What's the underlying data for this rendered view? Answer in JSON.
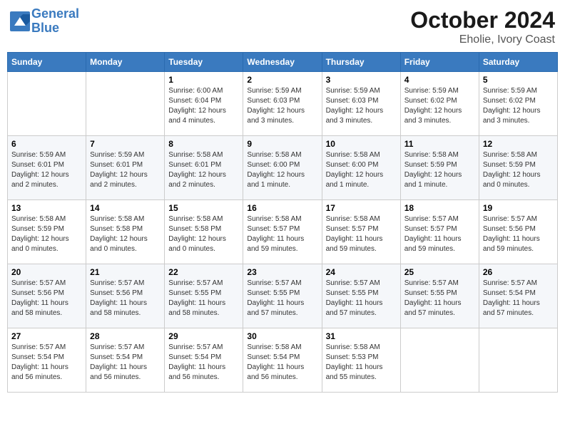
{
  "header": {
    "logo_line1": "General",
    "logo_line2": "Blue",
    "month_title": "October 2024",
    "location": "Eholie, Ivory Coast"
  },
  "weekdays": [
    "Sunday",
    "Monday",
    "Tuesday",
    "Wednesday",
    "Thursday",
    "Friday",
    "Saturday"
  ],
  "weeks": [
    [
      {
        "day": "",
        "info": ""
      },
      {
        "day": "",
        "info": ""
      },
      {
        "day": "1",
        "info": "Sunrise: 6:00 AM\nSunset: 6:04 PM\nDaylight: 12 hours\nand 4 minutes."
      },
      {
        "day": "2",
        "info": "Sunrise: 5:59 AM\nSunset: 6:03 PM\nDaylight: 12 hours\nand 3 minutes."
      },
      {
        "day": "3",
        "info": "Sunrise: 5:59 AM\nSunset: 6:03 PM\nDaylight: 12 hours\nand 3 minutes."
      },
      {
        "day": "4",
        "info": "Sunrise: 5:59 AM\nSunset: 6:02 PM\nDaylight: 12 hours\nand 3 minutes."
      },
      {
        "day": "5",
        "info": "Sunrise: 5:59 AM\nSunset: 6:02 PM\nDaylight: 12 hours\nand 3 minutes."
      }
    ],
    [
      {
        "day": "6",
        "info": "Sunrise: 5:59 AM\nSunset: 6:01 PM\nDaylight: 12 hours\nand 2 minutes."
      },
      {
        "day": "7",
        "info": "Sunrise: 5:59 AM\nSunset: 6:01 PM\nDaylight: 12 hours\nand 2 minutes."
      },
      {
        "day": "8",
        "info": "Sunrise: 5:58 AM\nSunset: 6:01 PM\nDaylight: 12 hours\nand 2 minutes."
      },
      {
        "day": "9",
        "info": "Sunrise: 5:58 AM\nSunset: 6:00 PM\nDaylight: 12 hours\nand 1 minute."
      },
      {
        "day": "10",
        "info": "Sunrise: 5:58 AM\nSunset: 6:00 PM\nDaylight: 12 hours\nand 1 minute."
      },
      {
        "day": "11",
        "info": "Sunrise: 5:58 AM\nSunset: 5:59 PM\nDaylight: 12 hours\nand 1 minute."
      },
      {
        "day": "12",
        "info": "Sunrise: 5:58 AM\nSunset: 5:59 PM\nDaylight: 12 hours\nand 0 minutes."
      }
    ],
    [
      {
        "day": "13",
        "info": "Sunrise: 5:58 AM\nSunset: 5:59 PM\nDaylight: 12 hours\nand 0 minutes."
      },
      {
        "day": "14",
        "info": "Sunrise: 5:58 AM\nSunset: 5:58 PM\nDaylight: 12 hours\nand 0 minutes."
      },
      {
        "day": "15",
        "info": "Sunrise: 5:58 AM\nSunset: 5:58 PM\nDaylight: 12 hours\nand 0 minutes."
      },
      {
        "day": "16",
        "info": "Sunrise: 5:58 AM\nSunset: 5:57 PM\nDaylight: 11 hours\nand 59 minutes."
      },
      {
        "day": "17",
        "info": "Sunrise: 5:58 AM\nSunset: 5:57 PM\nDaylight: 11 hours\nand 59 minutes."
      },
      {
        "day": "18",
        "info": "Sunrise: 5:57 AM\nSunset: 5:57 PM\nDaylight: 11 hours\nand 59 minutes."
      },
      {
        "day": "19",
        "info": "Sunrise: 5:57 AM\nSunset: 5:56 PM\nDaylight: 11 hours\nand 59 minutes."
      }
    ],
    [
      {
        "day": "20",
        "info": "Sunrise: 5:57 AM\nSunset: 5:56 PM\nDaylight: 11 hours\nand 58 minutes."
      },
      {
        "day": "21",
        "info": "Sunrise: 5:57 AM\nSunset: 5:56 PM\nDaylight: 11 hours\nand 58 minutes."
      },
      {
        "day": "22",
        "info": "Sunrise: 5:57 AM\nSunset: 5:55 PM\nDaylight: 11 hours\nand 58 minutes."
      },
      {
        "day": "23",
        "info": "Sunrise: 5:57 AM\nSunset: 5:55 PM\nDaylight: 11 hours\nand 57 minutes."
      },
      {
        "day": "24",
        "info": "Sunrise: 5:57 AM\nSunset: 5:55 PM\nDaylight: 11 hours\nand 57 minutes."
      },
      {
        "day": "25",
        "info": "Sunrise: 5:57 AM\nSunset: 5:55 PM\nDaylight: 11 hours\nand 57 minutes."
      },
      {
        "day": "26",
        "info": "Sunrise: 5:57 AM\nSunset: 5:54 PM\nDaylight: 11 hours\nand 57 minutes."
      }
    ],
    [
      {
        "day": "27",
        "info": "Sunrise: 5:57 AM\nSunset: 5:54 PM\nDaylight: 11 hours\nand 56 minutes."
      },
      {
        "day": "28",
        "info": "Sunrise: 5:57 AM\nSunset: 5:54 PM\nDaylight: 11 hours\nand 56 minutes."
      },
      {
        "day": "29",
        "info": "Sunrise: 5:57 AM\nSunset: 5:54 PM\nDaylight: 11 hours\nand 56 minutes."
      },
      {
        "day": "30",
        "info": "Sunrise: 5:58 AM\nSunset: 5:54 PM\nDaylight: 11 hours\nand 56 minutes."
      },
      {
        "day": "31",
        "info": "Sunrise: 5:58 AM\nSunset: 5:53 PM\nDaylight: 11 hours\nand 55 minutes."
      },
      {
        "day": "",
        "info": ""
      },
      {
        "day": "",
        "info": ""
      }
    ]
  ]
}
